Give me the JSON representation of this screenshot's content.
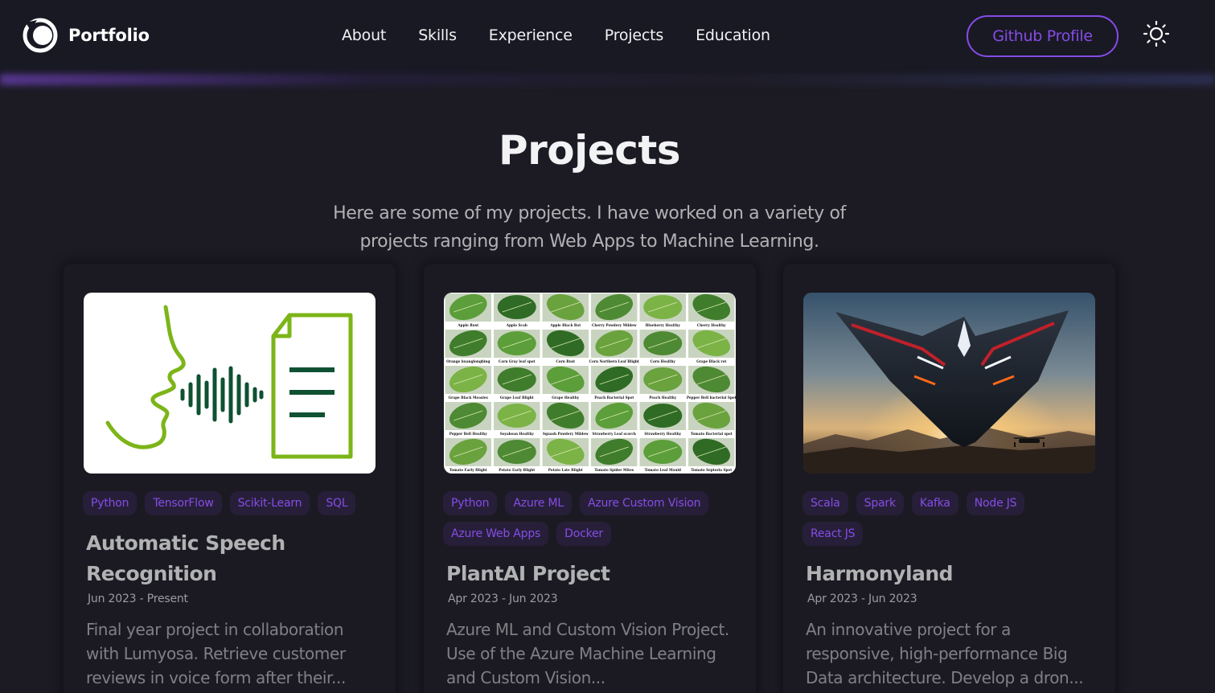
{
  "navbar": {
    "logo_text": "Portfolio",
    "links": [
      "About",
      "Skills",
      "Experience",
      "Projects",
      "Education"
    ],
    "github_button": "Github Profile",
    "theme_icon": "sun-icon"
  },
  "header": {
    "title": "Projects",
    "description": "Here are some of my projects. I have worked on a variety of projects ranging from Web Apps to Machine Learning."
  },
  "projects": [
    {
      "image_icon": "speech-to-text-icon",
      "tags": [
        "Python",
        "TensorFlow",
        "Scikit-Learn",
        "SQL"
      ],
      "title": "Automatic Speech Recognition",
      "date": "Jun 2023 - Present",
      "description": "Final year project in collaboration with Lumyosa. Retrieve customer reviews in voice form after their..."
    },
    {
      "image_icon": "plant-leaf-grid-image",
      "tags": [
        "Python",
        "Azure ML",
        "Azure Custom Vision",
        "Azure Web Apps",
        "Docker"
      ],
      "title": "PlantAI Project",
      "date": "Apr 2023 - Jun 2023",
      "description": "Azure ML and Custom Vision Project. Use of the Azure Machine Learning and Custom Vision...",
      "leaf_labels": [
        "Apple Rust",
        "Apple Scab",
        "Apple Black Rot",
        "Cherry Powdery Mildew",
        "Blueberry Healthy",
        "Cherry Healthy",
        "Orange huanglongbing",
        "Corn Gray leaf spot",
        "Corn Rust",
        "Corn Northern Leaf Blight",
        "Corn Healthy",
        "Grape Black rot",
        "Grape Black Measles",
        "Grape Leaf Blight",
        "Grape Healthy",
        "Peach Bacterial Spot",
        "Peach Healthy",
        "Pepper Bell bacterial Spot",
        "Pepper Bell Healthy",
        "Soyabean Healthy",
        "Squash Powdery Mildew",
        "Strawberry Leaf scorch",
        "Strawberry Healthy",
        "Tomato Bacterial spot",
        "Tomato Early Blight",
        "Potato Early Blight",
        "Potato Late Blight",
        "Tomato Spider Mites",
        "Tomato Leaf Mould",
        "Tomato Septoria Spot"
      ]
    },
    {
      "image_icon": "futuristic-aircraft-image",
      "tags": [
        "Scala",
        "Spark",
        "Kafka",
        "Node JS",
        "React JS"
      ],
      "title": "Harmonyland",
      "date": "Apr 2023 - Jun 2023",
      "description": "An innovative project for a responsive, high-performance Big Data architecture. Develop a dron..."
    }
  ],
  "colors": {
    "background": "#1c1b24",
    "navbar": "#191924",
    "accent": "#854ce6",
    "speech_icon_green": "#7cb518",
    "speech_icon_dark": "#0f5132"
  }
}
